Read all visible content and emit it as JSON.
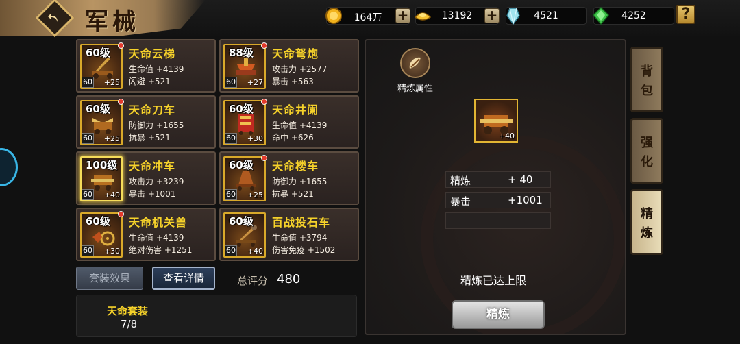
{
  "header": {
    "title": "军械",
    "resources": [
      {
        "icon": "gold-coin-icon",
        "value": "164万"
      },
      {
        "icon": "gold-ingot-icon",
        "value": "13192"
      },
      {
        "icon": "crystal-icon",
        "value": "4521"
      },
      {
        "icon": "jade-icon",
        "value": "4252"
      }
    ],
    "plus_label": "+",
    "help_label": "?"
  },
  "items": [
    {
      "level": "60级",
      "name": "天命云梯",
      "stat1": "生命值 +4139",
      "stat2": "闪避 +521",
      "tag_left": "60",
      "tag_right": "+25"
    },
    {
      "level": "88级",
      "name": "天命弩炮",
      "stat1": "攻击力 +2577",
      "stat2": "暴击 +563",
      "tag_left": "60",
      "tag_right": "+27"
    },
    {
      "level": "60级",
      "name": "天命刀车",
      "stat1": "防御力 +1655",
      "stat2": "抗暴 +521",
      "tag_left": "60",
      "tag_right": "+25"
    },
    {
      "level": "60级",
      "name": "天命井阑",
      "stat1": "生命值 +4139",
      "stat2": "命中 +626",
      "tag_left": "60",
      "tag_right": "+30"
    },
    {
      "level": "100级",
      "name": "天命冲车",
      "stat1": "攻击力 +3239",
      "stat2": "暴击 +1001",
      "tag_left": "60",
      "tag_right": "+40"
    },
    {
      "level": "60级",
      "name": "天命楼车",
      "stat1": "防御力 +1655",
      "stat2": "抗暴 +521",
      "tag_left": "60",
      "tag_right": "+25"
    },
    {
      "level": "60级",
      "name": "天命机关兽",
      "stat1": "生命值 +4139",
      "stat2": "绝对伤害 +1251",
      "tag_left": "60",
      "tag_right": "+30"
    },
    {
      "level": "60级",
      "name": "百战投石车",
      "stat1": "生命值 +3794",
      "stat2": "伤害免疫 +1502",
      "tag_left": "60",
      "tag_right": "+40"
    }
  ],
  "bottom": {
    "set_effect_label": "套装效果",
    "view_detail_label": "查看详情",
    "score_label": "总评分",
    "score_value": "480",
    "set_name": "天命套装",
    "set_count": "7/8"
  },
  "refine_panel": {
    "attr_label": "精炼属性",
    "slot_plus": "+40",
    "rows": [
      {
        "key": "精炼",
        "value": "+ 40"
      },
      {
        "key": "暴击",
        "value": "+1001"
      }
    ],
    "status": "精炼已达上限",
    "button_label": "精炼"
  },
  "side_tabs": [
    {
      "label": [
        "背",
        "包"
      ]
    },
    {
      "label": [
        "强",
        "化"
      ]
    },
    {
      "label": [
        "精",
        "炼"
      ],
      "active": true
    }
  ]
}
